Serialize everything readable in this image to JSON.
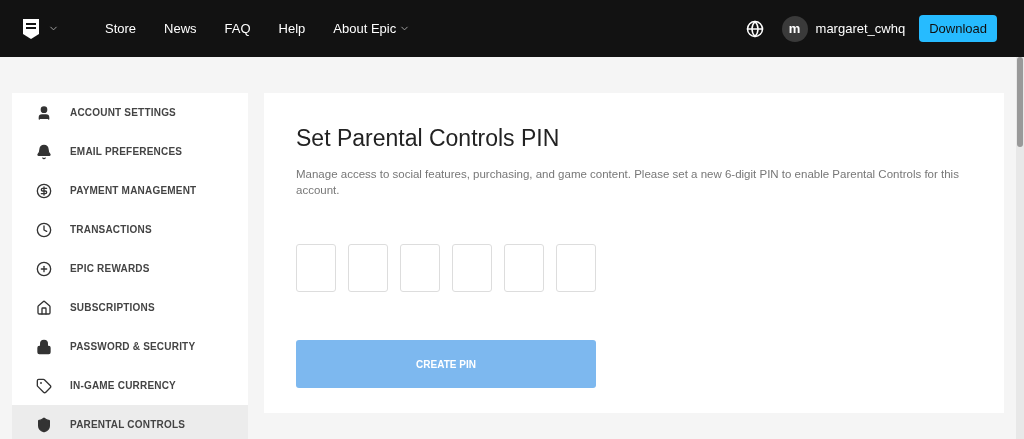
{
  "header": {
    "nav": [
      {
        "label": "Store",
        "dropdown": false
      },
      {
        "label": "News",
        "dropdown": false
      },
      {
        "label": "FAQ",
        "dropdown": false
      },
      {
        "label": "Help",
        "dropdown": false
      },
      {
        "label": "About Epic",
        "dropdown": true
      }
    ],
    "user": {
      "avatar_letter": "m",
      "name": "margaret_cwhq"
    },
    "download_button": "Download"
  },
  "sidebar": {
    "items": [
      {
        "label": "ACCOUNT SETTINGS",
        "selected": false
      },
      {
        "label": "EMAIL PREFERENCES",
        "selected": false
      },
      {
        "label": "PAYMENT MANAGEMENT",
        "selected": false
      },
      {
        "label": "TRANSACTIONS",
        "selected": false
      },
      {
        "label": "EPIC REWARDS",
        "selected": false
      },
      {
        "label": "SUBSCRIPTIONS",
        "selected": false
      },
      {
        "label": "PASSWORD & SECURITY",
        "selected": false
      },
      {
        "label": "IN-GAME CURRENCY",
        "selected": false
      },
      {
        "label": "PARENTAL CONTROLS",
        "selected": true
      }
    ]
  },
  "main": {
    "title": "Set Parental Controls PIN",
    "description": "Manage access to social features, purchasing, and game content. Please set a new 6-digit PIN to enable Parental Controls for this account.",
    "pin_fields": [
      {
        "filled": false
      },
      {
        "filled": false
      },
      {
        "filled": false
      },
      {
        "filled": false
      },
      {
        "filled": false
      },
      {
        "filled": false
      }
    ],
    "create_button": {
      "label": "CREATE PIN",
      "disabled": true
    }
  }
}
